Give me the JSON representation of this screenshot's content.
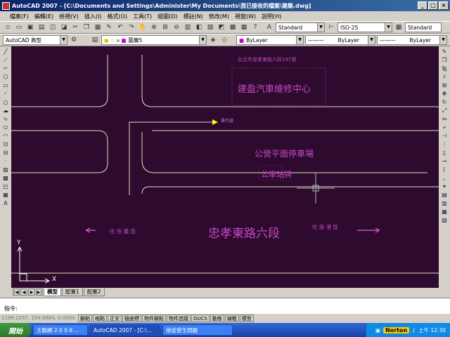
{
  "window": {
    "title": "AutoCAD 2007 - [C:\\Documents and Settings\\Administer\\My Documents\\我已接收的檔案\\建築.dwg]",
    "buttons": [
      "_",
      "□",
      "×"
    ]
  },
  "menu": [
    "檔案(F)",
    "編輯(E)",
    "檢視(V)",
    "插入(I)",
    "格式(O)",
    "工具(T)",
    "繪圖(D)",
    "標註(N)",
    "修改(M)",
    "視窗(W)",
    "說明(H)"
  ],
  "toolbar2": {
    "text_style": "Standard",
    "dim_style": "ISO-25",
    "table_style": "Standard"
  },
  "toolbar3": {
    "workspace": "AutoCAD 典型",
    "layer": "圖層5",
    "color": "ByLayer",
    "linetype": "ByLayer",
    "lineweight": "ByLayer"
  },
  "drawing": {
    "address": "台北市忠孝東路六段197號",
    "shop": "建盈汽車維修中心",
    "entrance": "單行道",
    "parking": "公營平面停車場",
    "bus": "公車站牌",
    "road": "忠孝東路六段",
    "to_left": "往 信 義 區",
    "to_right": "往 南 港 區",
    "axis_x": "X",
    "axis_y": "Y",
    "colors": {
      "background": "#2d0a2e",
      "lines": "#e0e0b8",
      "text": "#c54ac5",
      "yellow": "#ffff00"
    }
  },
  "tabs": {
    "model": "模型",
    "layout1": "配置1",
    "layout2": "配置2"
  },
  "command": {
    "prompt": "指令:"
  },
  "status": {
    "coords": "1199.2297, 334.8884, 0.0000",
    "buttons": [
      "鎖點",
      "格點",
      "正交",
      "極座標",
      "物件鎖點",
      "物件追蹤",
      "DUCS",
      "動態",
      "線粗",
      "模型"
    ]
  },
  "taskbar": {
    "start": "開始",
    "tasks": [
      "主聯網 2 0 0 6 ...",
      "AutoCAD 2007 - [C:\\...",
      "接從發生問題"
    ],
    "norton": "Norton",
    "clock": "上午 12:30"
  }
}
